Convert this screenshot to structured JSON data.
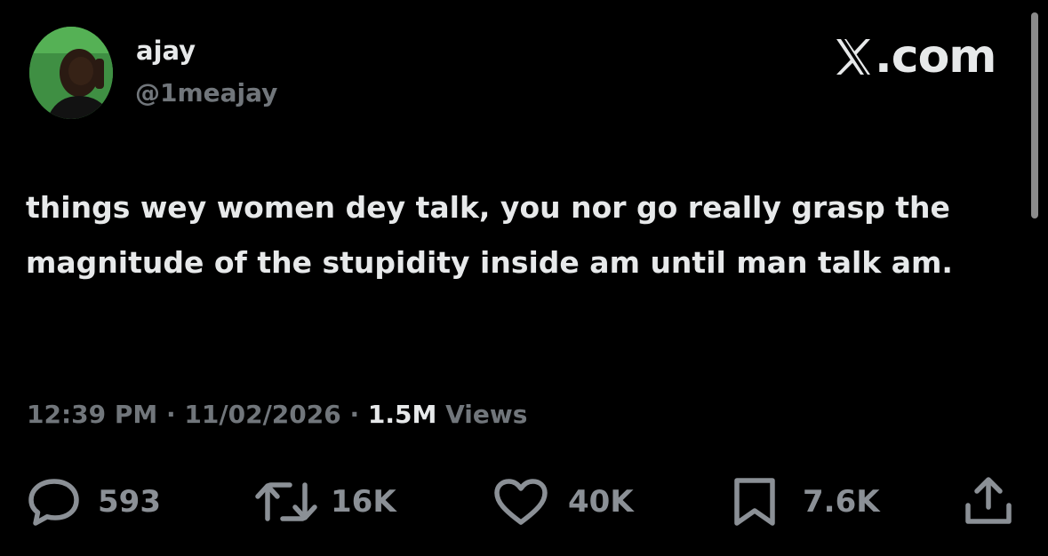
{
  "author": {
    "display_name": "ajay",
    "handle": "@1meajay"
  },
  "brand": {
    "label": ".com",
    "icon": "x-logo-icon"
  },
  "tweet": {
    "text": "things wey women dey talk, you nor go really grasp the magnitude of the stupidity inside am until man talk am."
  },
  "meta": {
    "time": "12:39 PM",
    "separator": " · ",
    "date": "11/02/2026",
    "views_count": "1.5M",
    "views_label": " Views"
  },
  "actions": {
    "replies": {
      "icon": "reply-icon",
      "count": "593"
    },
    "reposts": {
      "icon": "repost-icon",
      "count": "16K"
    },
    "likes": {
      "icon": "like-icon",
      "count": "40K"
    },
    "bookmarks": {
      "icon": "bookmark-icon",
      "count": "7.6K"
    },
    "share": {
      "icon": "share-icon"
    }
  },
  "colors": {
    "background": "#000000",
    "primary_text": "#e7e9ea",
    "secondary_text": "#71767b",
    "avatar_green": "#4caf50"
  }
}
